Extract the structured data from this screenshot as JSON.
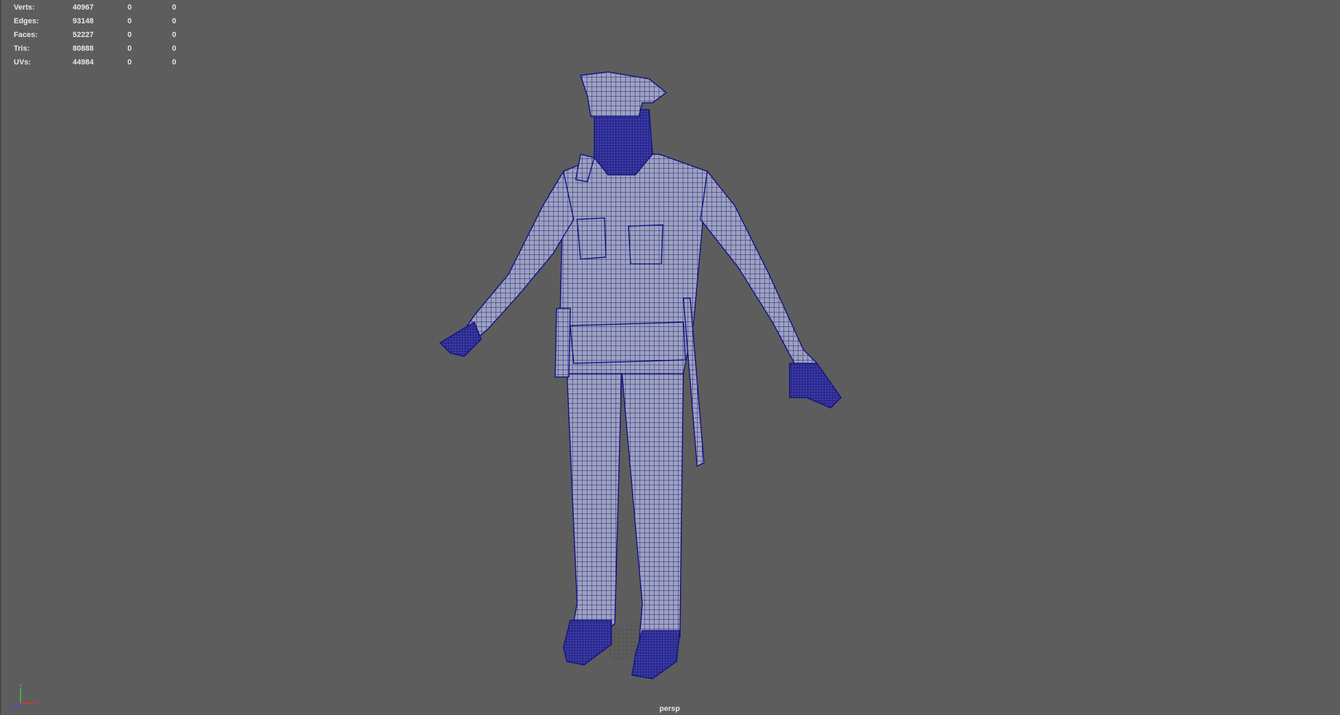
{
  "hud": {
    "rows": [
      {
        "label": "Verts:",
        "v1": "40967",
        "v2": "0",
        "v3": "0"
      },
      {
        "label": "Edges:",
        "v1": "93148",
        "v2": "0",
        "v3": "0"
      },
      {
        "label": "Faces:",
        "v1": "52227",
        "v2": "0",
        "v3": "0"
      },
      {
        "label": "Tris:",
        "v1": "80888",
        "v2": "0",
        "v3": "0"
      },
      {
        "label": "UVs:",
        "v1": "44984",
        "v2": "0",
        "v3": "0"
      }
    ]
  },
  "viewport": {
    "camera_label": "persp",
    "background_color": "#5d5d5d",
    "wireframe_color": "#1a1a8c"
  },
  "axis_gizmo": {
    "y_label": "Y",
    "x_label": "X",
    "z_label": "Z"
  }
}
